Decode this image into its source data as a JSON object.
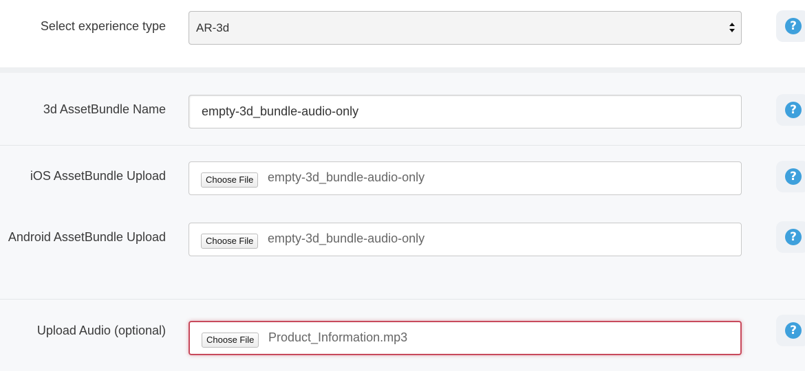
{
  "experience": {
    "label": "Select experience type",
    "selected": "AR-3d"
  },
  "bundle_name": {
    "label": "3d AssetBundle Name",
    "value": "empty-3d_bundle-audio-only"
  },
  "ios_upload": {
    "label": "iOS AssetBundle Upload",
    "button": "Choose File",
    "file": "empty-3d_bundle-audio-only"
  },
  "android_upload": {
    "label": "Android AssetBundle Upload",
    "button": "Choose File",
    "file": "empty-3d_bundle-audio-only"
  },
  "audio_upload": {
    "label": "Upload Audio (optional)",
    "button": "Choose File",
    "file": "Product_Information.mp3",
    "state": "error"
  },
  "help": {
    "glyph": "?",
    "icon": "question-circle-icon",
    "color": "#3ea0dc"
  },
  "colors": {
    "error_border": "#c84a5c",
    "panel_background": "#f7f8fa"
  }
}
